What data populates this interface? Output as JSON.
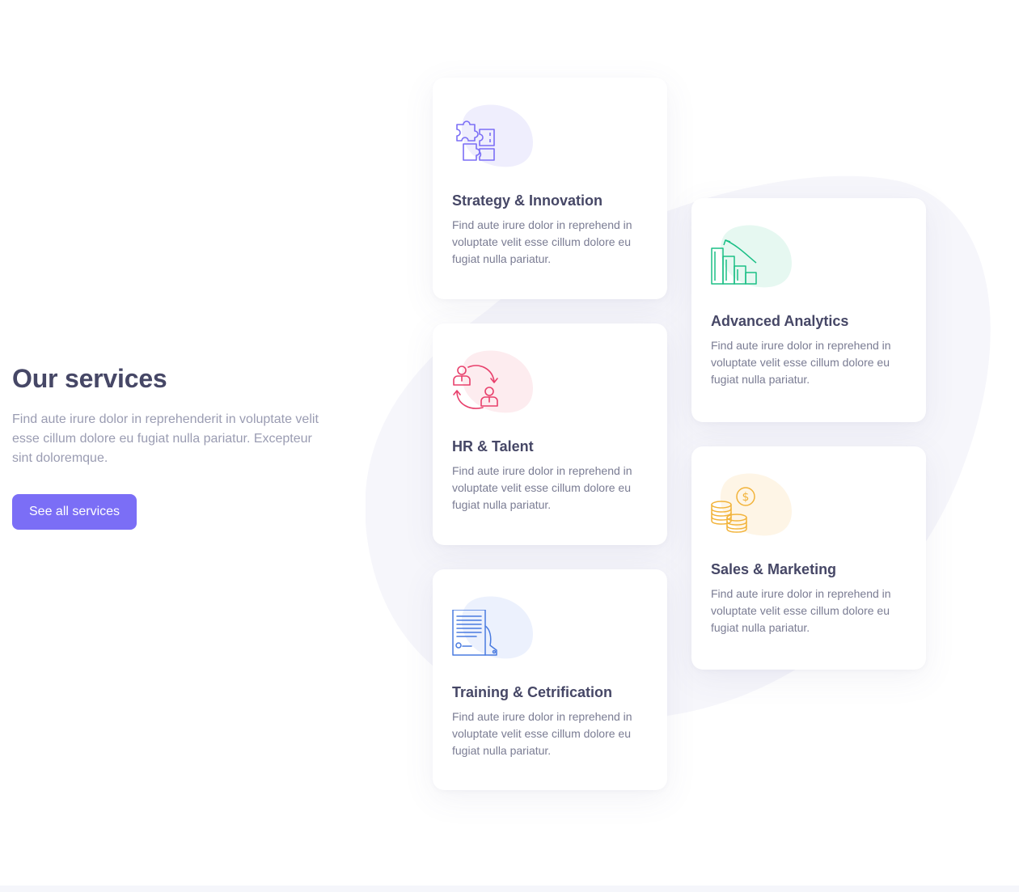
{
  "intro": {
    "title": "Our services",
    "description": "Find aute irure dolor in reprehenderit in voluptate velit esse cillum dolore eu fugiat nulla pariatur. Excepteur sint doloremque.",
    "button_label": "See all services"
  },
  "colors": {
    "accent": "#7b6ef6",
    "heading": "#464766",
    "strategy": "#7b6ef6",
    "hr": "#e8406c",
    "training": "#4a7be0",
    "analytics": "#1bbf86",
    "sales": "#f2b33a"
  },
  "services": [
    {
      "title": "Strategy & Innovation",
      "description": "Find aute irure dolor in reprehend in voluptate velit esse cillum dolore eu fugiat nulla pariatur.",
      "icon": "puzzle-icon"
    },
    {
      "title": "HR & Talent",
      "description": "Find aute irure dolor in reprehend in voluptate velit esse cillum dolore eu fugiat nulla pariatur.",
      "icon": "people-exchange-icon"
    },
    {
      "title": "Training & Cetrification",
      "description": "Find aute irure dolor in reprehend in voluptate velit esse cillum dolore eu fugiat nulla pariatur.",
      "icon": "certificate-icon"
    },
    {
      "title": "Advanced Analytics",
      "description": "Find aute irure dolor in reprehend in voluptate velit esse cillum dolore eu fugiat nulla pariatur.",
      "icon": "bar-chart-icon"
    },
    {
      "title": "Sales & Marketing",
      "description": "Find aute irure dolor in reprehend in voluptate velit esse cillum dolore eu fugiat nulla pariatur.",
      "icon": "coins-icon"
    }
  ]
}
